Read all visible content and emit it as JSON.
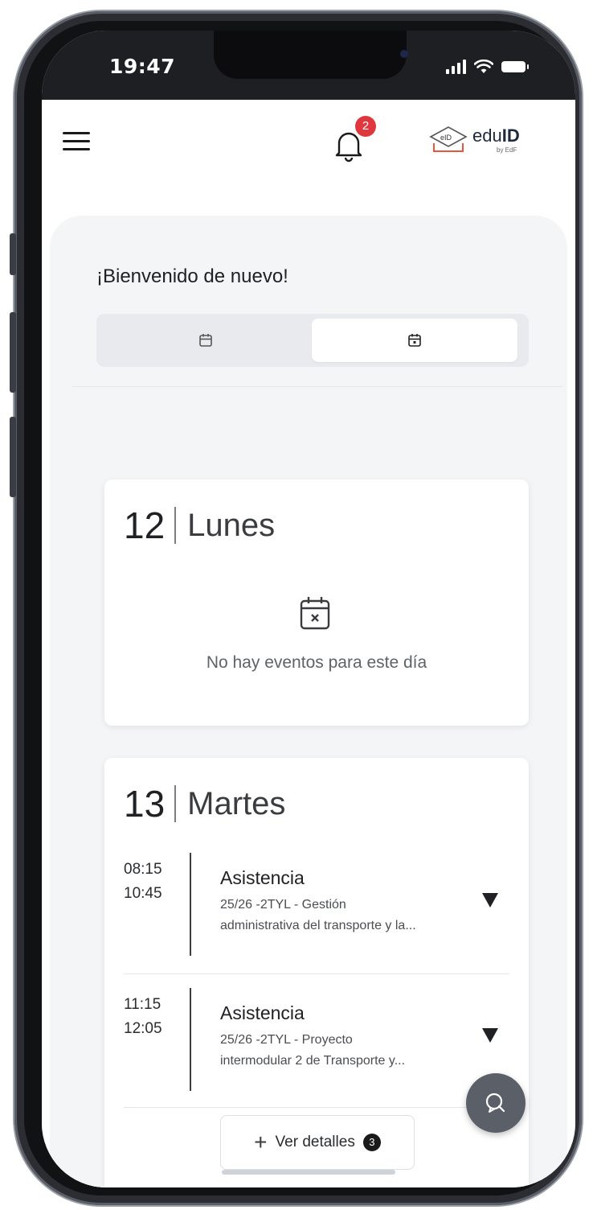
{
  "status_bar": {
    "time": "19:47"
  },
  "header": {
    "notification_count": "2",
    "logo_text": "eduID",
    "logo_bold": "ID",
    "logo_prefix": "edu",
    "logo_sub": "by EdF",
    "logo_mark": "eID"
  },
  "welcome": {
    "title": "¡Bienvenido de nuevo!"
  },
  "view_toggle": {
    "options": [
      "calendar-week-icon",
      "calendar-day-icon"
    ],
    "selected": 1
  },
  "days": [
    {
      "number": "12",
      "name": "Lunes",
      "empty_text": "No hay eventos para este día"
    },
    {
      "number": "13",
      "name": "Martes",
      "events": [
        {
          "start": "08:15",
          "end": "10:45",
          "title": "Asistencia",
          "desc_line1": "25/26 -2TYL - Gestión",
          "desc_line2": "administrativa del transporte y la..."
        },
        {
          "start": "11:15",
          "end": "12:05",
          "title": "Asistencia",
          "desc_line1": "25/26 -2TYL - Proyecto",
          "desc_line2": "intermodular 2 de Transporte y..."
        }
      ],
      "details_button": {
        "label": "Ver detalles",
        "count": "3"
      }
    }
  ],
  "colors": {
    "badge": "#e0373e",
    "fab": "#5b6068",
    "logo_accent": "#e8553a"
  }
}
